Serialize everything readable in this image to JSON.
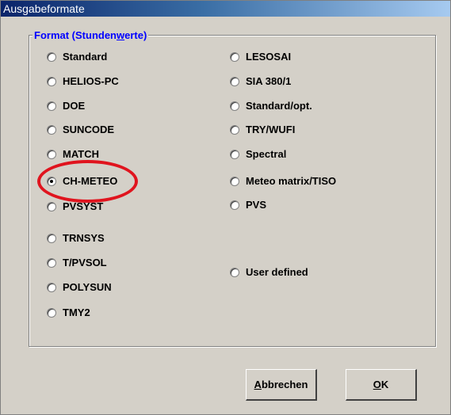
{
  "window": {
    "title": "Ausgabeformate"
  },
  "group": {
    "legend_pre": "Format (Stunden",
    "legend_ul": "w",
    "legend_post": "erte)"
  },
  "formats": {
    "left": [
      "Standard",
      "HELIOS-PC",
      "DOE",
      "SUNCODE",
      "MATCH",
      "CH-METEO",
      "PVSYST",
      "TRNSYS",
      "T/PVSOL",
      "POLYSUN",
      "TMY2"
    ],
    "right": [
      "LESOSAI",
      "SIA 380/1",
      "Standard/opt.",
      "TRY/WUFI",
      "Spectral",
      "Meteo matrix/TISO",
      "PVS",
      "User defined"
    ],
    "selected": "CH-METEO"
  },
  "buttons": {
    "cancel_ul": "A",
    "cancel_rest": "bbrechen",
    "ok_ul": "O",
    "ok_rest": "K"
  },
  "colors": {
    "title_bar": "#0a246a",
    "legend_text": "#0000ff",
    "highlight": "#e0141e"
  }
}
